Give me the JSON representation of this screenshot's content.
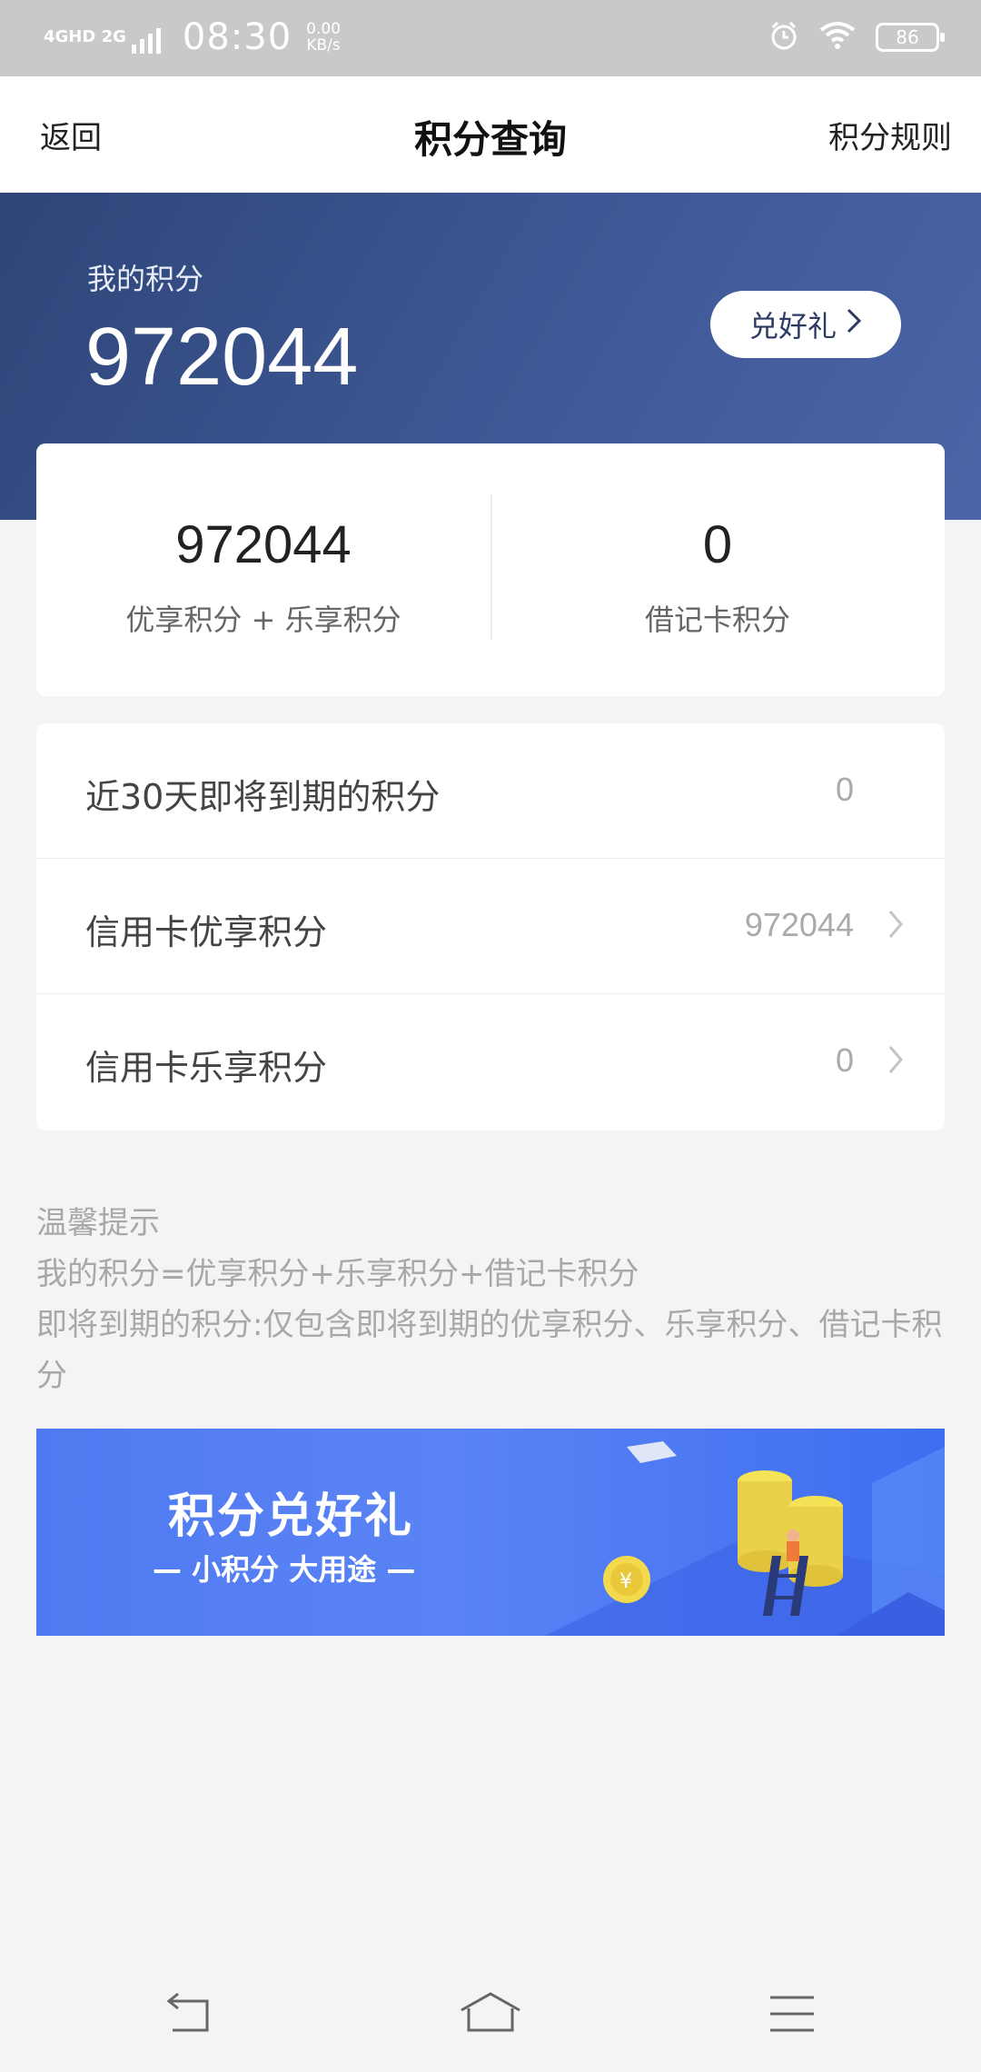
{
  "status_bar": {
    "network_label": "4GHD 2G",
    "time": "08:30",
    "speed_value": "0.00",
    "speed_unit": "KB/s",
    "battery": "86"
  },
  "nav": {
    "back_label": "返回",
    "title": "积分查询",
    "rules_label": "积分规则"
  },
  "hero": {
    "label": "我的积分",
    "value": "972044",
    "gift_button_label": "兑好礼"
  },
  "summary": {
    "left_value": "972044",
    "left_label": "优享积分 + 乐享积分",
    "right_value": "0",
    "right_label": "借记卡积分"
  },
  "list": {
    "rows": [
      {
        "label": "近30天即将到期的积分",
        "value": "0",
        "has_chevron": false
      },
      {
        "label": "信用卡优享积分",
        "value": "972044",
        "has_chevron": true
      },
      {
        "label": "信用卡乐享积分",
        "value": "0",
        "has_chevron": true
      }
    ]
  },
  "tips": {
    "heading": "温馨提示",
    "line1": "我的积分=优享积分+乐享积分+借记卡积分",
    "line2": "即将到期的积分:仅包含即将到期的优享积分、乐享积分、借记卡积分"
  },
  "banner": {
    "title": "积分兑好礼",
    "subtitle": "— 小积分 大用途 —"
  },
  "colors": {
    "hero_start": "#2f4578",
    "hero_end": "#4c65a8",
    "banner_blue": "#4f79f0",
    "muted_text": "#a8a8a8"
  },
  "icons": {
    "alarm": "alarm-icon",
    "wifi": "wifi-icon",
    "back_nav": "back-nav-icon",
    "home_nav": "home-nav-icon",
    "menu_nav": "menu-nav-icon"
  }
}
